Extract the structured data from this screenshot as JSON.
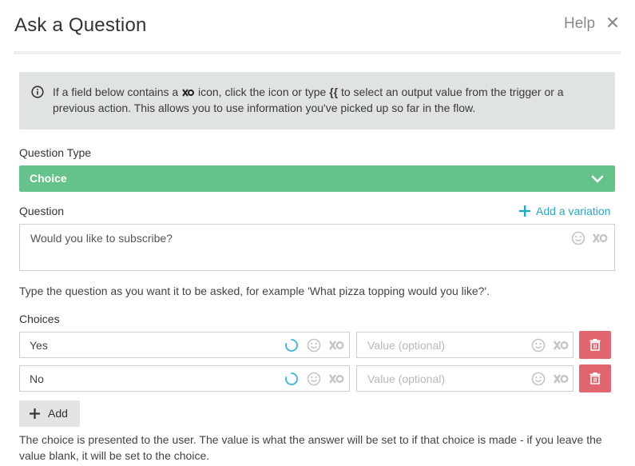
{
  "header": {
    "title": "Ask a Question",
    "help_label": "Help",
    "close_glyph": "✕"
  },
  "info": {
    "text_before_icon": "If a field below contains a",
    "text_after_icon": "icon, click the icon or type",
    "braces": "{{",
    "text_after_braces": "to select an output value from the trigger or a previous action. This allows you to use information you've picked up so far in the flow.",
    "icon": "info-circle-icon",
    "inline_icon": "output-value-icon"
  },
  "question_type": {
    "label": "Question Type",
    "value": "Choice",
    "accent": "#66c28b"
  },
  "question": {
    "label": "Question",
    "add_variation_label": "Add a variation",
    "value": "Would you like to subscribe?",
    "help": "Type the question as you want it to be asked, for example 'What pizza topping would you like?'."
  },
  "choices": {
    "label": "Choices",
    "items": [
      {
        "choice": "Yes",
        "value_placeholder": "Value (optional)"
      },
      {
        "choice": "No",
        "value_placeholder": "Value (optional)"
      }
    ],
    "add_label": "Add",
    "help": "The choice is presented to the user. The value is what the answer will be set to if that choice is made - if you leave the value blank, it will be set to the choice.",
    "delete_color": "#e0656e"
  },
  "colors": {
    "link": "#25a8c9",
    "info_bg": "#dfe3e1"
  }
}
